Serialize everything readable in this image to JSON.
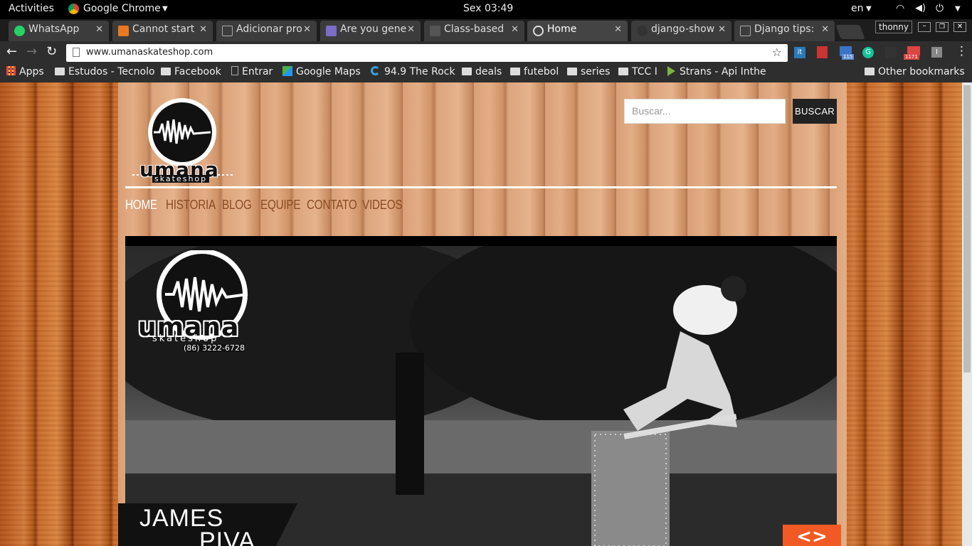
{
  "topbar": {
    "activities": "Activities",
    "app_name": "Google Chrome",
    "clock": "Sex 03:49",
    "lang": "en"
  },
  "tabs": [
    {
      "label": "WhatsApp",
      "icon": "whatsapp-icon",
      "color": "#25d366"
    },
    {
      "label": "Cannot start",
      "icon": "stackoverflow-icon",
      "color": "#e87922"
    },
    {
      "label": "Adicionar pro",
      "icon": "page-icon",
      "color": "#888888"
    },
    {
      "label": "Are you gene",
      "icon": "w-icon",
      "color": "#7b6cc5"
    },
    {
      "label": "Class-based",
      "icon": "page-icon",
      "color": "#555555"
    },
    {
      "label": "Home",
      "icon": "globe-icon",
      "color": "#dddddd",
      "active": true
    },
    {
      "label": "django-show",
      "icon": "github-icon",
      "color": "#333333"
    },
    {
      "label": "Django tips:",
      "icon": "page-icon",
      "color": "#888888"
    }
  ],
  "window": {
    "user": "thonny"
  },
  "toolbar": {
    "url": "www.umanaskateshop.com",
    "badge_count": "115",
    "mail_count": "1171"
  },
  "bookmarks": [
    {
      "label": "Apps",
      "icon": "apps-grid-icon"
    },
    {
      "label": "Estudos - Tecnolo",
      "icon": "folder-icon"
    },
    {
      "label": "Facebook",
      "icon": "folder-icon"
    },
    {
      "label": "Entrar",
      "icon": "page-icon"
    },
    {
      "label": "Google Maps",
      "icon": "maps-icon"
    },
    {
      "label": "94.9 The Rock",
      "icon": "radio-icon"
    },
    {
      "label": "deals",
      "icon": "folder-icon"
    },
    {
      "label": "futebol",
      "icon": "folder-icon"
    },
    {
      "label": "series",
      "icon": "folder-icon"
    },
    {
      "label": "TCC I",
      "icon": "folder-icon"
    },
    {
      "label": "Strans - Api Inthe",
      "icon": "play-icon"
    },
    {
      "label": "Other bookmarks",
      "icon": "folder-icon"
    }
  ],
  "site": {
    "logo_text": "umana",
    "logo_sub": "skateshop",
    "phone": "(86) 3222-6728",
    "search_placeholder": "Buscar...",
    "search_button": "BUSCAR",
    "nav": [
      "HOME",
      "HISTORIA",
      "BLOG",
      "EQUIPE",
      "CONTATO",
      "VIDEOS"
    ],
    "slide_caption_1": "JAMES",
    "slide_caption_2": "PIVA",
    "next_icon": "code-arrows-icon"
  }
}
